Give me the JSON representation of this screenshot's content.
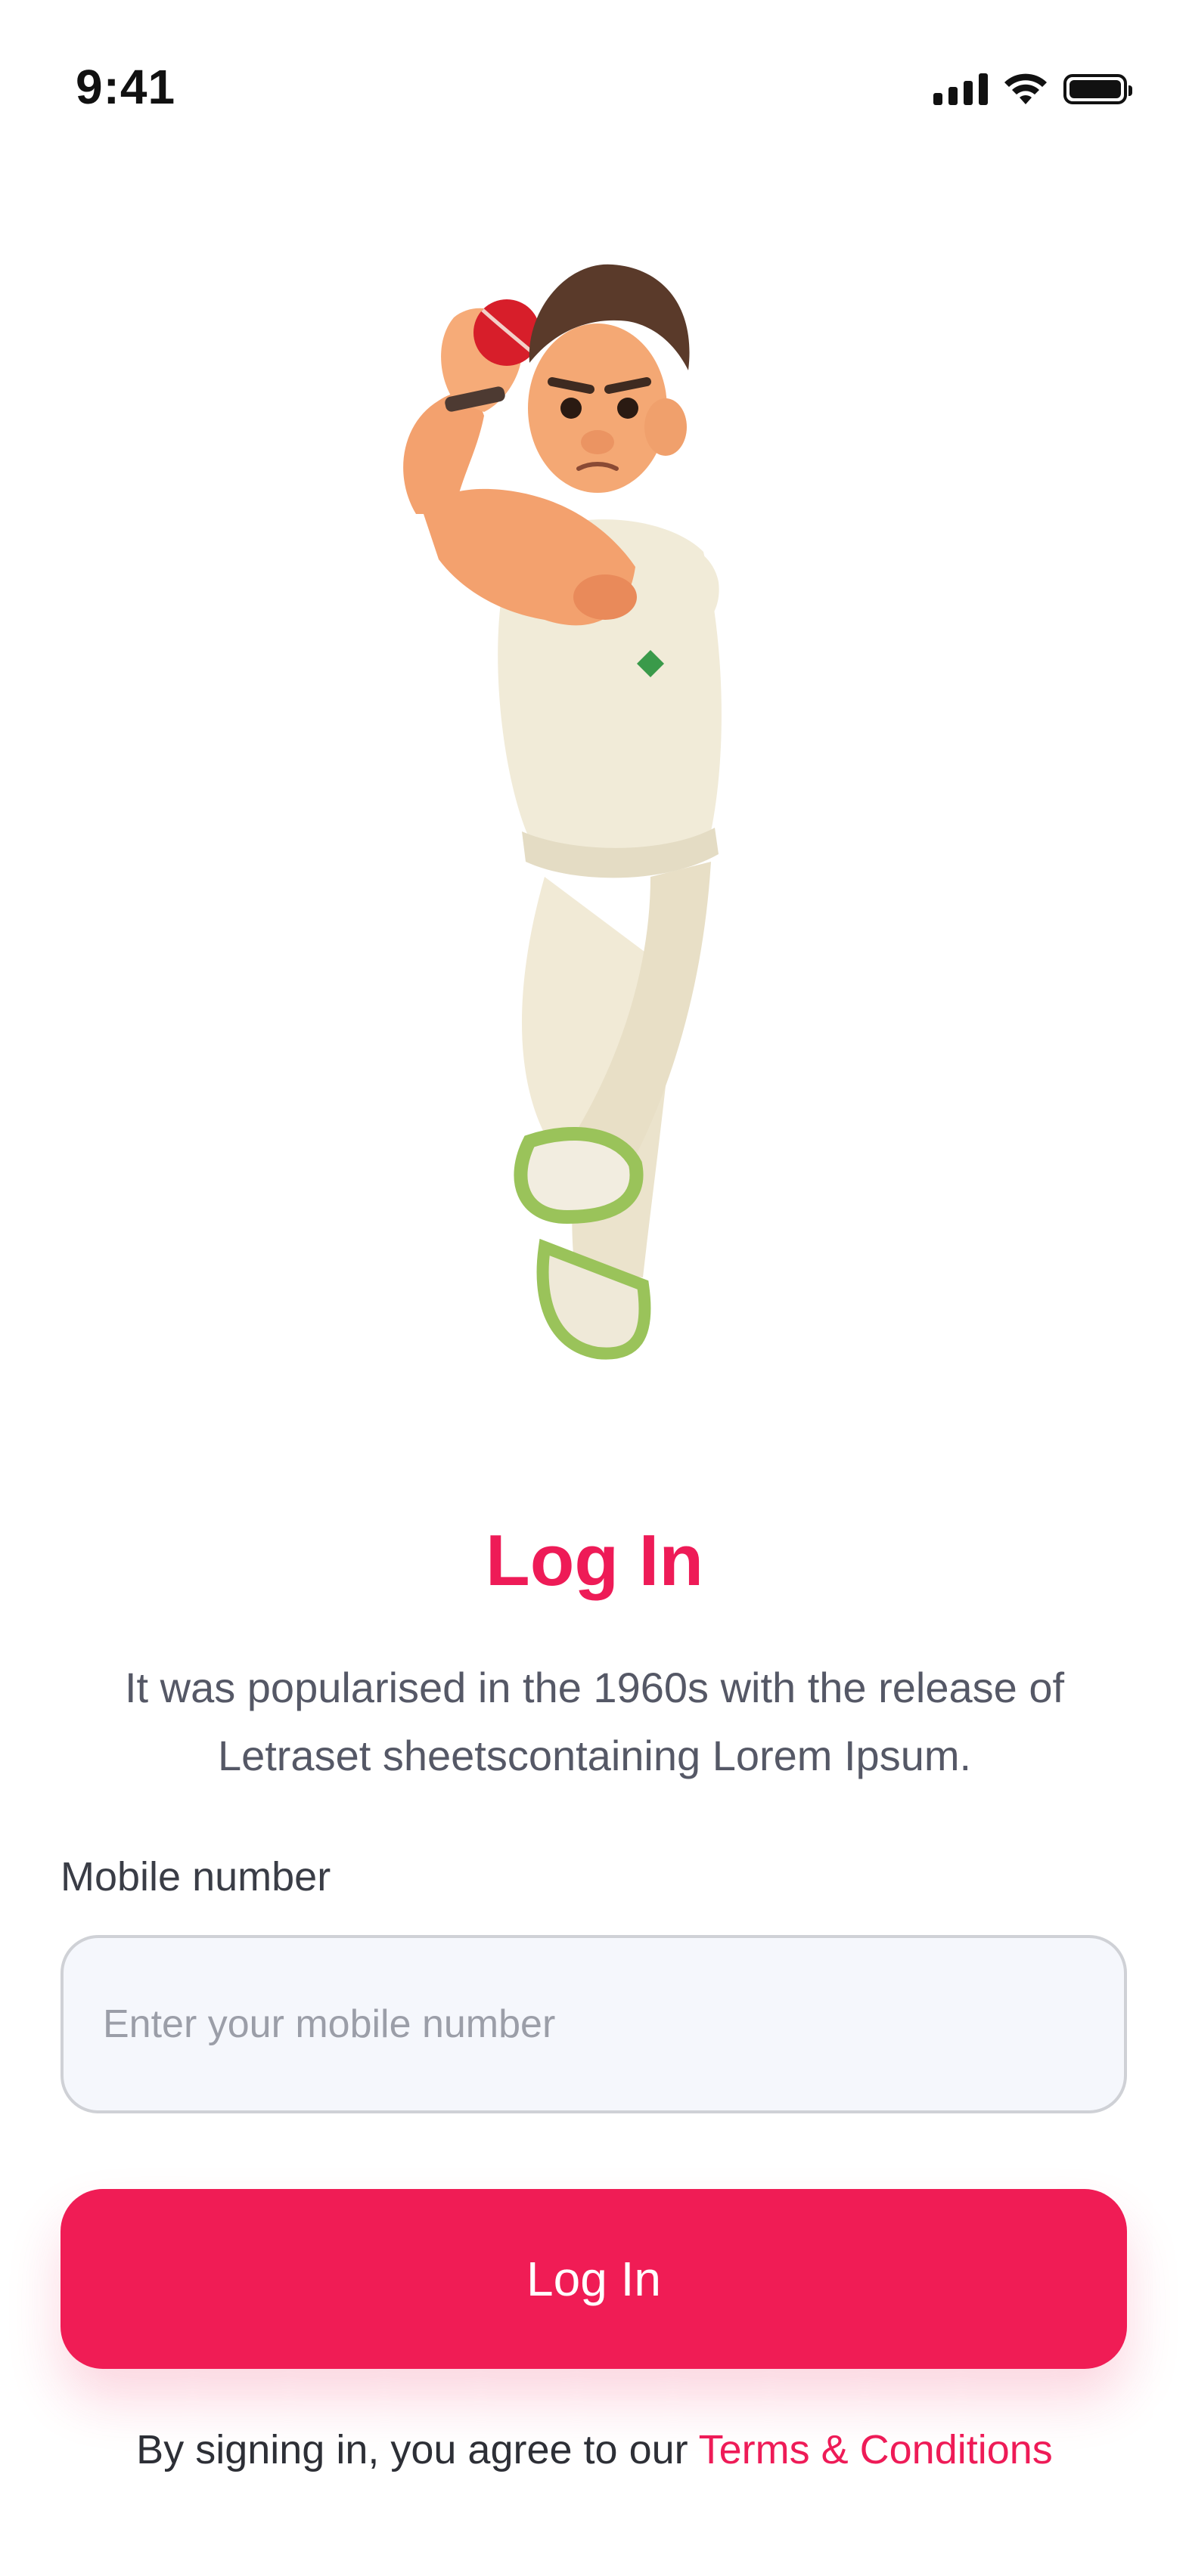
{
  "status_bar": {
    "time": "9:41"
  },
  "hero": {
    "illustration": "cartoon cricket bowler holding red ball"
  },
  "login": {
    "title": "Log In",
    "subtitle": "It was popularised in the 1960s with the release of Letraset sheetscontaining Lorem Ipsum.",
    "mobile_label": "Mobile number",
    "mobile_placeholder": "Enter your mobile number",
    "mobile_value": "",
    "button_label": "Log In",
    "terms_prefix": "By signing in, you agree to our",
    "terms_link": "Terms & Conditions"
  },
  "colors": {
    "accent": "#f01c55",
    "title": "#ee1b57",
    "input_bg": "#f5f7fc"
  }
}
